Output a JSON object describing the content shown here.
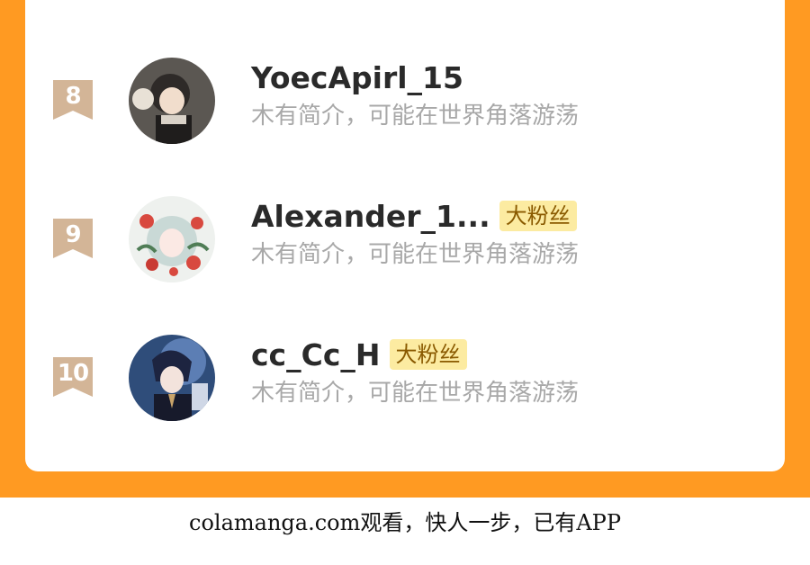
{
  "colors": {
    "accent": "#FF9A22",
    "badge_bg": "#FCEBA1",
    "rank_bg": "#D3B597"
  },
  "list": [
    {
      "rank": "8",
      "username": "YoecApirl_15",
      "badge": "",
      "bio": "木有简介，可能在世界角落游荡"
    },
    {
      "rank": "9",
      "username": "Alexander_1...",
      "badge": "大粉丝",
      "bio": "木有简介，可能在世界角落游荡"
    },
    {
      "rank": "10",
      "username": "cc_Cc_H",
      "badge": "大粉丝",
      "bio": "木有简介，可能在世界角落游荡"
    }
  ],
  "footer": {
    "watermark": "colamanga.com观看，快人一步，已有APP"
  }
}
